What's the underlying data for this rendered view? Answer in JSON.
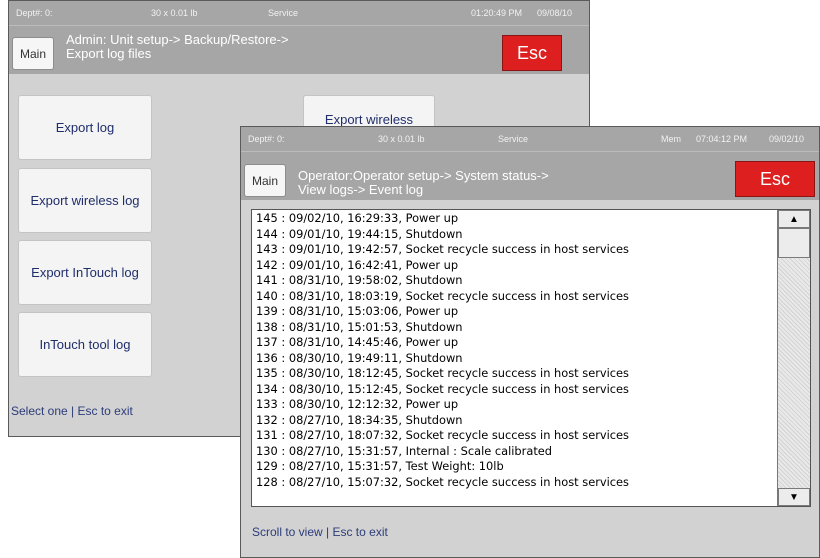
{
  "back_window": {
    "status_bar": {
      "dept": "Dept#: 0:",
      "scale": "30 x 0.01 lb",
      "mode": "Service",
      "time": "01:20:49 PM",
      "date": "09/08/10"
    },
    "header": {
      "main_label": "Main",
      "path_line1": "Admin: Unit setup-> Backup/Restore->",
      "path_line2": "Export log files",
      "esc_label": "Esc"
    },
    "options": [
      {
        "label": "Export log"
      },
      {
        "label": "Export wireless log"
      },
      {
        "label": "Export InTouch log"
      },
      {
        "label": "InTouch tool log"
      },
      {
        "label": "Export wireless"
      }
    ],
    "footer": "Select one | Esc to exit"
  },
  "front_window": {
    "status_bar": {
      "dept": "Dept#: 0:",
      "scale": "30 x 0.01 lb",
      "mode": "Service",
      "mem": "Mem",
      "time": "07:04:12 PM",
      "date": "09/02/10"
    },
    "header": {
      "main_label": "Main",
      "path_line1": "Operator:Operator setup-> System status->",
      "path_line2": "View logs-> Event log",
      "esc_label": "Esc"
    },
    "log_entries": [
      "145 : 09/02/10, 16:29:33, Power up",
      "144 : 09/01/10, 19:44:15, Shutdown",
      "143 : 09/01/10, 19:42:57, Socket recycle success in host services",
      "142 : 09/01/10, 16:42:41, Power up",
      "141 : 08/31/10, 19:58:02, Shutdown",
      "140 : 08/31/10, 18:03:19, Socket recycle success in host services",
      "139 : 08/31/10, 15:03:06, Power up",
      "138 : 08/31/10, 15:01:53, Shutdown",
      "137 : 08/31/10, 14:45:46, Power up",
      "136 : 08/30/10, 19:49:11, Shutdown",
      "135 : 08/30/10, 18:12:45, Socket recycle success in host services",
      "134 : 08/30/10, 15:12:45, Socket recycle success in host services",
      "133 : 08/30/10, 12:12:32, Power up",
      "132 : 08/27/10, 18:34:35, Shutdown",
      "131 : 08/27/10, 18:07:32, Socket recycle success in host services",
      "130 : 08/27/10, 15:31:57, Internal : Scale calibrated",
      "129 : 08/27/10, 15:31:57, Test Weight: 10lb",
      "128 : 08/27/10, 15:07:32, Socket recycle success in host services"
    ],
    "scroll_up_icon": "▲",
    "scroll_down_icon": "▼",
    "footer": "Scroll to view | Esc to exit"
  }
}
